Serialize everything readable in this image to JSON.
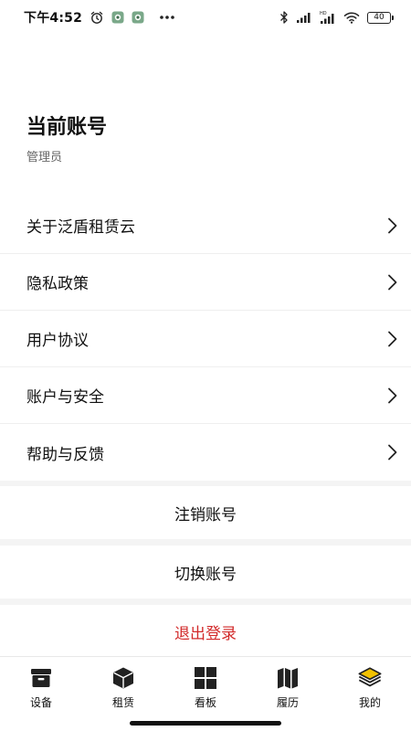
{
  "status_bar": {
    "time": "下午4:52",
    "battery": "40",
    "icons": [
      "alarm-icon",
      "app-notification-icon",
      "app-notification-icon",
      "more-icon",
      "bluetooth-icon",
      "signal-icon",
      "signal-hd-icon",
      "wifi-icon",
      "battery-icon"
    ]
  },
  "account": {
    "title": "当前账号",
    "role": "管理员"
  },
  "menu": {
    "items": [
      {
        "label": "关于泛盾租赁云",
        "icon": "chevron-right-icon"
      },
      {
        "label": "隐私政策",
        "icon": "chevron-right-icon"
      },
      {
        "label": "用户协议",
        "icon": "chevron-right-icon"
      },
      {
        "label": "账户与安全",
        "icon": "chevron-right-icon"
      },
      {
        "label": "帮助与反馈",
        "icon": "chevron-right-icon"
      }
    ]
  },
  "actions": {
    "deregister": "注销账号",
    "switch": "切换账号",
    "logout": "退出登录"
  },
  "tabbar": {
    "items": [
      {
        "label": "设备",
        "icon": "archive-box-icon"
      },
      {
        "label": "租赁",
        "icon": "cube-icon"
      },
      {
        "label": "看板",
        "icon": "grid-icon"
      },
      {
        "label": "履历",
        "icon": "map-icon"
      },
      {
        "label": "我的",
        "icon": "layers-icon",
        "active": true
      }
    ]
  },
  "colors": {
    "accent": "#f2c200",
    "logout": "#d22a2a",
    "text": "#111111",
    "secondary_text": "#666666",
    "divider": "#efefef",
    "group_background": "#f4f4f4"
  }
}
